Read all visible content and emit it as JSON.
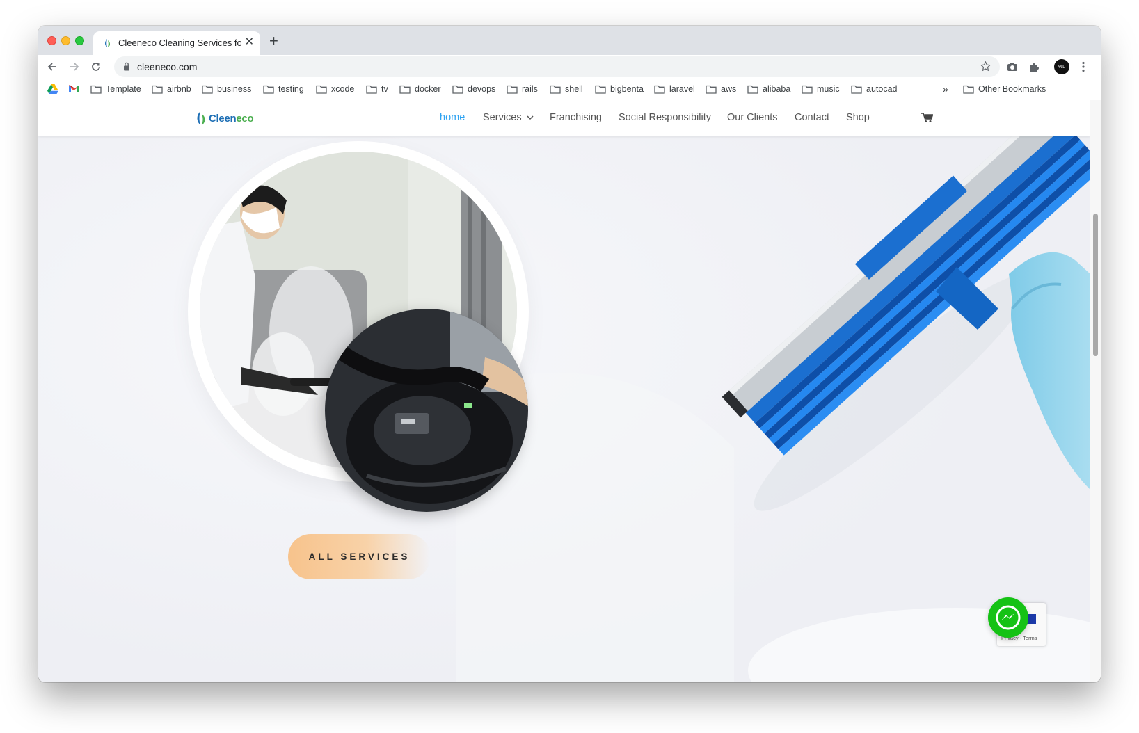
{
  "browser": {
    "tab_title": "Cleeneco Cleaning Services fo",
    "url": "cleeneco.com",
    "profile_initials": "%L"
  },
  "bookmarks": {
    "items": [
      "Template",
      "airbnb",
      "business",
      "testing",
      "xcode",
      "tv",
      "docker",
      "devops",
      "rails",
      "shell",
      "bigbenta",
      "laravel",
      "aws",
      "alibaba",
      "music",
      "autocad"
    ],
    "overflow": "»",
    "other": "Other Bookmarks"
  },
  "site": {
    "logo_primary": "Cleen",
    "logo_secondary": "eco",
    "menu": {
      "home": "home",
      "services": "Services",
      "franchising": "Franchising",
      "social": "Social Responsibility",
      "clients": "Our Clients",
      "contact": "Contact",
      "shop": "Shop"
    },
    "accent_color": "#2ea3f2"
  },
  "hero": {
    "cta_label": "ALL SERVICES"
  },
  "recaptcha": {
    "text": "Privacy - Terms"
  }
}
